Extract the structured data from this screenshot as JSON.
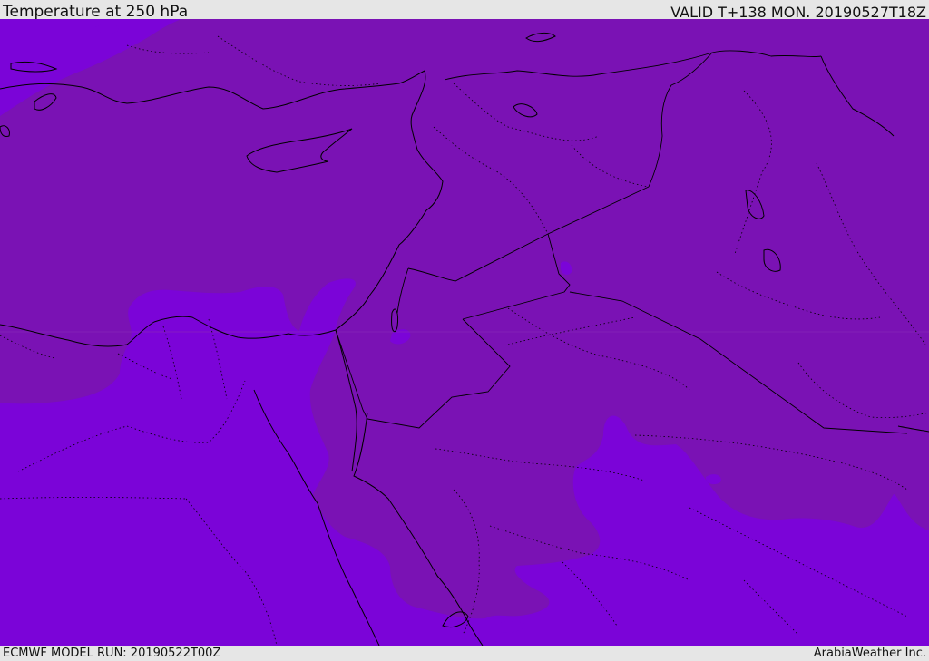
{
  "header": {
    "title": "Temperature at 250 hPa",
    "valid": "VALID T+138 MON. 20190527T18Z"
  },
  "footer": {
    "model_run": "ECMWF MODEL RUN: 20190522T00Z",
    "credit": "ArabiaWeather Inc."
  },
  "colors": {
    "warmer_band": "#7a12b4",
    "colder_band": "#7b04d8",
    "boundary_line": "#000000"
  }
}
